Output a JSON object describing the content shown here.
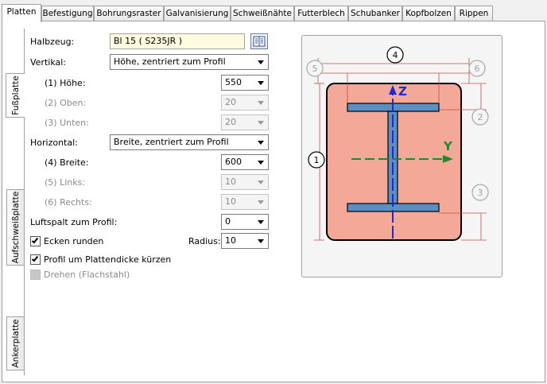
{
  "tabs": [
    {
      "label": "Platten",
      "active": true
    },
    {
      "label": "Befestigung",
      "active": false
    },
    {
      "label": "Bohrungsraster",
      "active": false
    },
    {
      "label": "Galvanisierung",
      "active": false
    },
    {
      "label": "Schweißnähte",
      "active": false
    },
    {
      "label": "Futterblech",
      "active": false
    },
    {
      "label": "Schubanker",
      "active": false
    },
    {
      "label": "Kopfbolzen",
      "active": false
    },
    {
      "label": "Rippen",
      "active": false
    }
  ],
  "side_tabs": [
    {
      "label": "Fußplatte",
      "active": true
    },
    {
      "label": "Aufschweißplatte",
      "active": false
    },
    {
      "label": "Ankerplatte",
      "active": false
    }
  ],
  "form": {
    "halbzeug_label": "Halbzeug:",
    "halbzeug_value": "Bl 15  ( S235JR )",
    "vertikal_label": "Vertikal:",
    "vertikal_value": "Höhe, zentriert zum Profil",
    "hoehe_label": "(1) Höhe:",
    "hoehe_value": "550",
    "oben_label": "(2) Oben:",
    "oben_value": "20",
    "unten_label": "(3) Unten:",
    "unten_value": "20",
    "horizontal_label": "Horizontal:",
    "horizontal_value": "Breite, zentriert zum Profil",
    "breite_label": "(4) Breite:",
    "breite_value": "600",
    "links_label": "(5) Links:",
    "links_value": "10",
    "rechts_label": "(6) Rechts:",
    "rechts_value": "10",
    "luftspalt_label": "Luftspalt zum Profil:",
    "luftspalt_value": "0",
    "ecken_label": "Ecken runden",
    "ecken_checked": true,
    "radius_label": "Radius:",
    "radius_value": "10",
    "profil_label": "Profil um Plattendicke kürzen",
    "profil_checked": true,
    "drehen_label": "Drehen (Flachstahl)",
    "drehen_checked": false
  },
  "diagram": {
    "axis_z": "Z",
    "axis_y": "Y",
    "markers": [
      "1",
      "2",
      "3",
      "4",
      "5",
      "6"
    ],
    "colors": {
      "plate": "#f4a898",
      "profile": "#5b8fc3",
      "z_axis": "#1a2ed6",
      "y_axis": "#1f8a2e",
      "dimension": "#c0504d"
    }
  }
}
